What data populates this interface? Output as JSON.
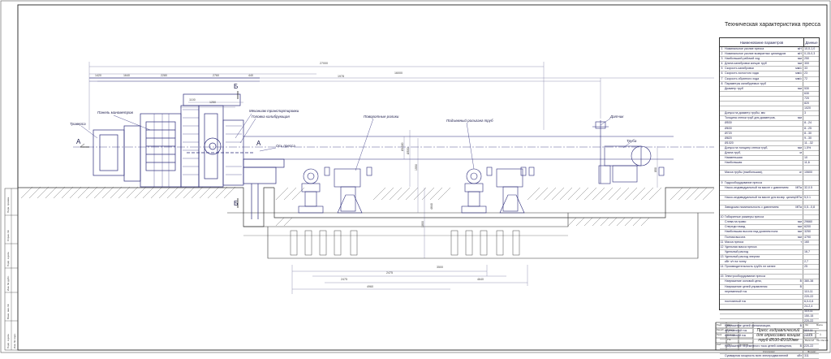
{
  "sheet": {
    "title": "Техническая характеристика пресса",
    "stamp_title": "Пресс гидравлический для опрессовки концов труб Ø530-Ø1020мм",
    "stamp_fields": [
      "Лит.",
      "Масса",
      "Масштаб",
      "Лист",
      "Листов",
      "Изм.",
      "Лист",
      "№ докум.",
      "Подп.",
      "Дата",
      "Разраб.",
      "Пров.",
      "Т.контр.",
      "Н.контр.",
      "Утв."
    ],
    "stamp_scale": "1:20",
    "stamp_sheet": "1",
    "side_labels": [
      "Перв. примен.",
      "Справ. №",
      "Подп. и дата",
      "Инв. № дубл.",
      "Взам. инв. №",
      "Подп. и дата",
      "Инв. № подл."
    ],
    "bottom_labels": [
      "Копировал",
      "Формат"
    ]
  },
  "drawing": {
    "callouts": {
      "traverse": "Траверса",
      "manifold": "Панель манометров",
      "transport": "Механизм транспортировки",
      "head": "Головка калибрующая",
      "axis": "Ось пресса",
      "rollers": "Поворотные ролики",
      "rollgang": "Подъемный рольганг труб",
      "sensor": "Датчик",
      "pipe": "Труба"
    },
    "section_marks": [
      "А",
      "А",
      "Б",
      "Б"
    ],
    "dimensions_top": [
      "27000",
      "16000",
      "1978",
      "1420",
      "1640",
      "2280",
      "2760",
      "1100",
      "440",
      "1250"
    ],
    "dimensions_bottom": [
      "3500",
      "2475",
      "4960",
      "4640",
      "2475"
    ],
    "dimensions_vertical": [
      "Ø1020",
      "Ø530",
      "1550",
      "1800",
      "4640",
      "850"
    ]
  },
  "table": {
    "header": {
      "name": "Наименование параметров",
      "value": "Данные"
    },
    "rows": [
      {
        "n": "1",
        "p": "Номинальное усилие пресса",
        "u": "мН",
        "v": "10,0-1,0"
      },
      {
        "n": "2",
        "p": "Номинальное усилие возвратных цилиндров",
        "u": "мН",
        "v": "0,15-0,3"
      },
      {
        "n": "3",
        "p": "Наибольший рабочий ход",
        "u": "мм",
        "v": "250"
      },
      {
        "n": "4",
        "p": "Длина калибровки концов труб",
        "u": "мм",
        "v": "300"
      },
      {
        "n": "5",
        "p": "Скорость калибровки",
        "u": "мм/с",
        "v": "33"
      },
      {
        "n": "6",
        "p": "Скорость холостого хода",
        "u": "мм/с",
        "v": "23"
      },
      {
        "n": "7",
        "p": "Скорость обратного хода",
        "u": "мм/с",
        "v": "72"
      },
      {
        "n": "8",
        "p": "Параметры калибруемых труб",
        "u": "",
        "v": ""
      },
      {
        "n": "",
        "p": "Диаметр труб",
        "u": "мм",
        "v": "530"
      },
      {
        "n": "",
        "p": "",
        "u": "",
        "v": "630"
      },
      {
        "n": "",
        "p": "",
        "u": "",
        "v": "720"
      },
      {
        "n": "",
        "p": "",
        "u": "",
        "v": "820"
      },
      {
        "n": "",
        "p": "",
        "u": "",
        "v": "1020"
      },
      {
        "n": "",
        "p": "Допуск на диаметр трубы, мм",
        "u": "",
        "v": "3"
      },
      {
        "n": "",
        "p": "Толщина стенки труб для диаметров,",
        "u": "мм",
        "v": ""
      },
      {
        "n": "",
        "p": "Ø530",
        "u": "",
        "v": "8...24"
      },
      {
        "n": "",
        "p": "Ø630",
        "u": "",
        "v": "8...25"
      },
      {
        "n": "",
        "p": "Ø720",
        "u": "",
        "v": "8...30"
      },
      {
        "n": "",
        "p": "Ø820",
        "u": "",
        "v": "9...30"
      },
      {
        "n": "",
        "p": "Ø1020",
        "u": "",
        "v": "11...32"
      },
      {
        "n": "",
        "p": "Допуск на толщину стенки труб,",
        "u": "мм",
        "v": "1,5%"
      },
      {
        "n": "",
        "p": "Длина труб,",
        "u": "м",
        "v": ""
      },
      {
        "n": "",
        "p": "Наименьшая",
        "u": "",
        "v": "10"
      },
      {
        "n": "",
        "p": "Наибольшая",
        "u": "",
        "v": "11,6"
      },
      {
        "n": "",
        "p": "",
        "u": "",
        "v": ""
      },
      {
        "n": "",
        "p": "Масса трубы (наибольшая),",
        "u": "кг",
        "v": "10600"
      },
      {
        "n": "",
        "p": "",
        "u": "",
        "v": ""
      },
      {
        "n": "9",
        "p": "Гидрооборудование пресса",
        "u": "",
        "v": ""
      },
      {
        "n": "",
        "p": "Насос-индивидуальный на масле с давлением",
        "u": "МПа",
        "v": "32,0.5"
      },
      {
        "n": "",
        "p": "",
        "u": "",
        "v": ""
      },
      {
        "n": "",
        "p": "Насос-индивидуальный на масле для возвр. цилиндров",
        "u": "МПа",
        "v": "5,0.1"
      },
      {
        "n": "",
        "p": "",
        "u": "",
        "v": ""
      },
      {
        "n": "",
        "p": "Заводская номинальность с давлением",
        "u": "МПа",
        "v": "0,5...0,8"
      },
      {
        "n": "",
        "p": "",
        "u": "",
        "v": ""
      },
      {
        "n": "10",
        "p": "Габаритные размеры пресса",
        "u": "",
        "v": ""
      },
      {
        "n": "",
        "p": "Слева на право",
        "u": "мм",
        "v": "29660"
      },
      {
        "n": "",
        "p": "Спереди назад",
        "u": "мм",
        "v": "6200"
      },
      {
        "n": "",
        "p": "Наибольшая высота над уровнем пола",
        "u": "мм",
        "v": "3250"
      },
      {
        "n": "",
        "p": "Полная высота",
        "u": "мм",
        "v": "4790"
      },
      {
        "n": "11",
        "p": "Масса пресса",
        "u": "т",
        "v": "160"
      },
      {
        "n": "12",
        "p": "Удельная масса пресса",
        "u": "",
        "v": ""
      },
      {
        "n": "",
        "p": "Удельный расход",
        "u": "",
        "v": "16,7"
      },
      {
        "n": "13",
        "p": "Удельный расход энергии",
        "u": "",
        "v": ""
      },
      {
        "n": "",
        "p": "кВт·ч/т на тонну",
        "u": "",
        "v": "2,7"
      },
      {
        "n": "14",
        "p": "Производительность труб/ч не менее",
        "u": "",
        "v": "25"
      },
      {
        "n": "",
        "p": "",
        "u": "",
        "v": ""
      },
      {
        "n": "15",
        "p": "Электрооборудование пресса",
        "u": "",
        "v": ""
      },
      {
        "n": "",
        "p": "Напряжение силовой цепи,",
        "u": "В",
        "v": "380-38"
      },
      {
        "n": "",
        "p": "Напряжение цепей управления",
        "u": "В",
        "v": ""
      },
      {
        "n": "",
        "p": "переменный ток",
        "u": "",
        "v": "110-11"
      },
      {
        "n": "",
        "p": "",
        "u": "",
        "v": "220-22"
      },
      {
        "n": "",
        "p": "постоянный ток",
        "u": "",
        "v": "6,0-0,6"
      },
      {
        "n": "",
        "p": "",
        "u": "",
        "v": "24-2,4"
      },
      {
        "n": "",
        "p": "",
        "u": "",
        "v": "110-11"
      },
      {
        "n": "",
        "p": "",
        "u": "",
        "v": "150-15"
      },
      {
        "n": "",
        "p": "",
        "u": "",
        "v": "220-22"
      },
      {
        "n": "",
        "p": "Напряжение цепей сигнализации,",
        "u": "В",
        "v": ""
      },
      {
        "n": "",
        "p": "переменный ток",
        "u": "",
        "v": "110-11"
      },
      {
        "n": "",
        "p": "постоянный ток",
        "u": "",
        "v": "24-2,4"
      },
      {
        "n": "",
        "p": "",
        "u": "",
        "v": ""
      },
      {
        "n": "",
        "p": "Напряжение переменного тока цепей освещения,",
        "u": "В",
        "v": "220-22"
      },
      {
        "n": "",
        "p": "",
        "u": "",
        "v": ""
      },
      {
        "n": "",
        "p": "Суммарная мощность всех электродвигателей",
        "u": "кВт",
        "v": "311"
      }
    ]
  },
  "colors": {
    "line": "#2b2b7a",
    "dim": "#6a6a9a",
    "ground": "#3b3b3b",
    "ink": "#1a1a4a"
  }
}
